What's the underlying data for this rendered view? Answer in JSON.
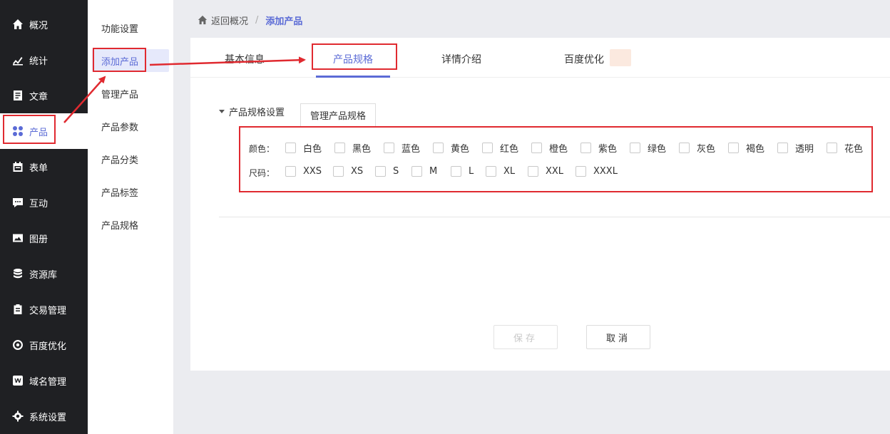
{
  "sidebar": {
    "items": [
      {
        "label": "概况",
        "icon": "home-icon"
      },
      {
        "label": "统计",
        "icon": "chart-icon"
      },
      {
        "label": "文章",
        "icon": "article-icon"
      },
      {
        "label": "产品",
        "icon": "grid-icon"
      },
      {
        "label": "表单",
        "icon": "calendar-icon"
      },
      {
        "label": "互动",
        "icon": "chat-icon"
      },
      {
        "label": "图册",
        "icon": "album-icon"
      },
      {
        "label": "资源库",
        "icon": "database-icon"
      },
      {
        "label": "交易管理",
        "icon": "clipboard-icon"
      },
      {
        "label": "百度优化",
        "icon": "target-icon"
      },
      {
        "label": "域名管理",
        "icon": "domain-icon"
      },
      {
        "label": "系统设置",
        "icon": "gear-icon"
      }
    ]
  },
  "submenu": {
    "items": [
      "功能设置",
      "添加产品",
      "管理产品",
      "产品参数",
      "产品分类",
      "产品标签",
      "产品规格"
    ]
  },
  "breadcrumb": {
    "back": "返回概况",
    "current": "添加产品"
  },
  "tabs": [
    "基本信息",
    "产品规格",
    "详情介绍",
    "百度优化"
  ],
  "spec": {
    "title": "产品规格设置",
    "manage": "管理产品规格",
    "color_label": "颜色：",
    "colors": [
      "白色",
      "黑色",
      "蓝色",
      "黄色",
      "红色",
      "橙色",
      "紫色",
      "绿色",
      "灰色",
      "褐色",
      "透明",
      "花色"
    ],
    "size_label": "尺码：",
    "sizes": [
      "XXS",
      "XS",
      "S",
      "M",
      "L",
      "XL",
      "XXL",
      "XXXL"
    ]
  },
  "buttons": {
    "save": "保存",
    "cancel": "取消"
  },
  "colors": {
    "accent": "#5b6bd6",
    "annotation": "#e02a30",
    "sidebar": "#1f2023"
  }
}
